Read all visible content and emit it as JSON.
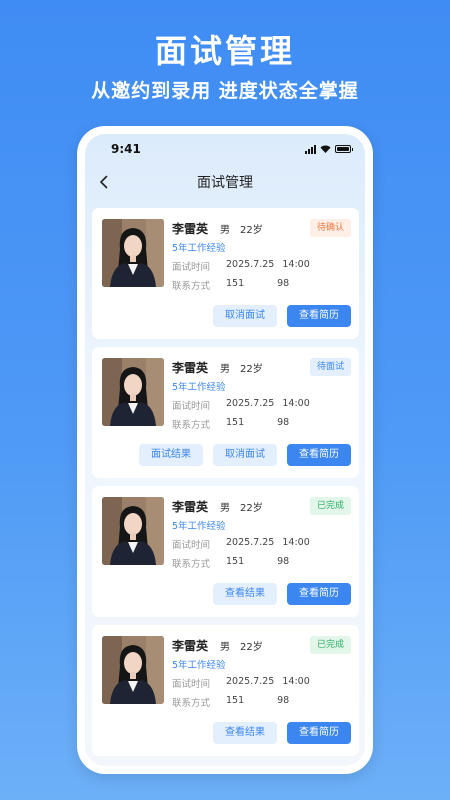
{
  "promo": {
    "title": "面试管理",
    "subtitle": "从邀约到录用 进度状态全掌握"
  },
  "statusbar": {
    "time": "9:41"
  },
  "navbar": {
    "title": "面试管理"
  },
  "labels": {
    "interview_time": "面试时间",
    "contact": "联系方式"
  },
  "colors": {
    "accent": "#3b86f0",
    "pending": "#ef7a3c",
    "done": "#2fae67"
  },
  "cards": [
    {
      "name": "李雷英",
      "gender": "男",
      "age": "22岁",
      "experience": "5年工作经验",
      "date": "2025.7.25",
      "time": "14:00",
      "phone_prefix": "151",
      "phone_suffix": "98",
      "status": "待确认",
      "buttons": [
        "取消面试",
        "查看简历"
      ]
    },
    {
      "name": "李雷英",
      "gender": "男",
      "age": "22岁",
      "experience": "5年工作经验",
      "date": "2025.7.25",
      "time": "14:00",
      "phone_prefix": "151",
      "phone_suffix": "98",
      "status": "待面试",
      "buttons": [
        "面试结果",
        "取消面试",
        "查看简历"
      ]
    },
    {
      "name": "李雷英",
      "gender": "男",
      "age": "22岁",
      "experience": "5年工作经验",
      "date": "2025.7.25",
      "time": "14:00",
      "phone_prefix": "151",
      "phone_suffix": "98",
      "status": "已完成",
      "buttons": [
        "查看结果",
        "查看简历"
      ]
    },
    {
      "name": "李雷英",
      "gender": "男",
      "age": "22岁",
      "experience": "5年工作经验",
      "date": "2025.7.25",
      "time": "14:00",
      "phone_prefix": "151",
      "phone_suffix": "98",
      "status": "已完成",
      "buttons": [
        "查看结果",
        "查看简历"
      ]
    }
  ]
}
